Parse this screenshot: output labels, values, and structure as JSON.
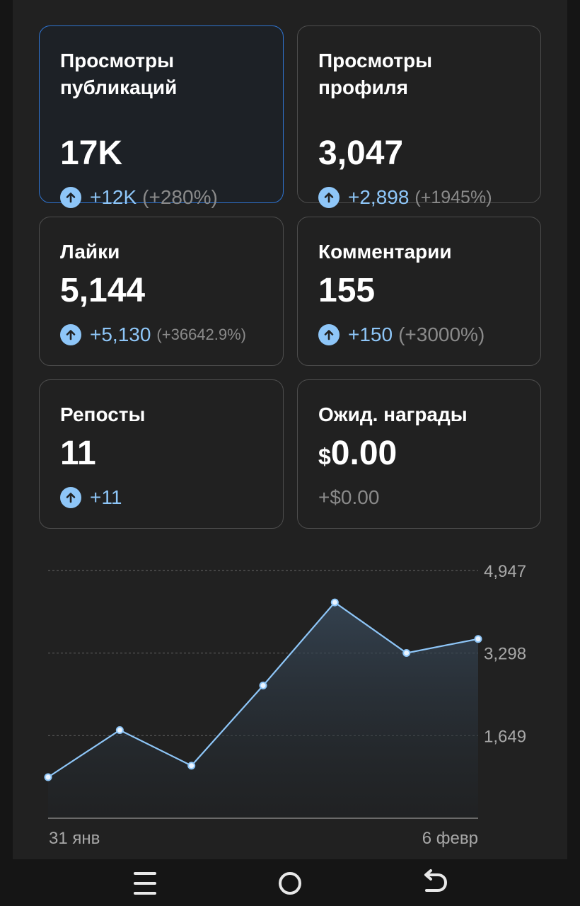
{
  "cards": [
    {
      "title": "Просмотры\nпубликаций",
      "value": "17K",
      "delta": "+12K",
      "pct": "(+280%)"
    },
    {
      "title": "Просмотры\nпрофиля",
      "value": "3,047",
      "delta": "+2,898",
      "pct": "(+1945%)"
    },
    {
      "title": "Лайки",
      "value": "5,144",
      "delta": "+5,130",
      "pct": "(+36642.9%)"
    },
    {
      "title": "Комментарии",
      "value": "155",
      "delta": "+150",
      "pct": "(+3000%)"
    },
    {
      "title": "Репосты",
      "value": "11",
      "delta": "+11"
    },
    {
      "title": "Ожид. награды",
      "currency": "$",
      "value": "0.00",
      "delta": "+$0.00"
    }
  ],
  "chart_data": {
    "type": "area",
    "x_start_label": "31 янв",
    "x_end_label": "6 февр",
    "y_ticks": [
      "1,649",
      "3,298",
      "4,947"
    ],
    "ylim": [
      0,
      4947
    ],
    "values": [
      820,
      1760,
      1050,
      2650,
      4310,
      3300,
      3580
    ],
    "line_color": "#8ec6f8"
  }
}
